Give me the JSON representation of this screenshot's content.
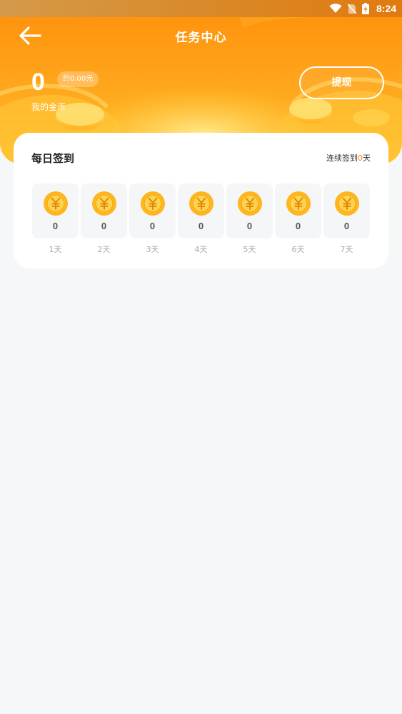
{
  "status_bar": {
    "time": "8:24",
    "icons": [
      "wifi-icon",
      "no-sim-icon",
      "battery-charging-icon"
    ]
  },
  "header": {
    "title": "任务中心",
    "back_icon": "back-arrow-icon"
  },
  "balance": {
    "coins": "0",
    "approx_value": "约0.00元",
    "label": "我的金币",
    "withdraw_label": "提现"
  },
  "checkin": {
    "title": "每日签到",
    "streak_prefix": "连续签到",
    "streak_days": "0",
    "streak_suffix": "天",
    "coin_icon": "yuan-coin-icon",
    "days": [
      {
        "label": "1天",
        "coins": "0"
      },
      {
        "label": "2天",
        "coins": "0"
      },
      {
        "label": "3天",
        "coins": "0"
      },
      {
        "label": "4天",
        "coins": "0"
      },
      {
        "label": "5天",
        "coins": "0"
      },
      {
        "label": "6天",
        "coins": "0"
      },
      {
        "label": "7天",
        "coins": "0"
      }
    ]
  },
  "colors": {
    "header_orange": "#ff9a12",
    "accent": "#ff8a00",
    "background": "#f6f7f9",
    "coin_gold": "#ffb51c"
  }
}
